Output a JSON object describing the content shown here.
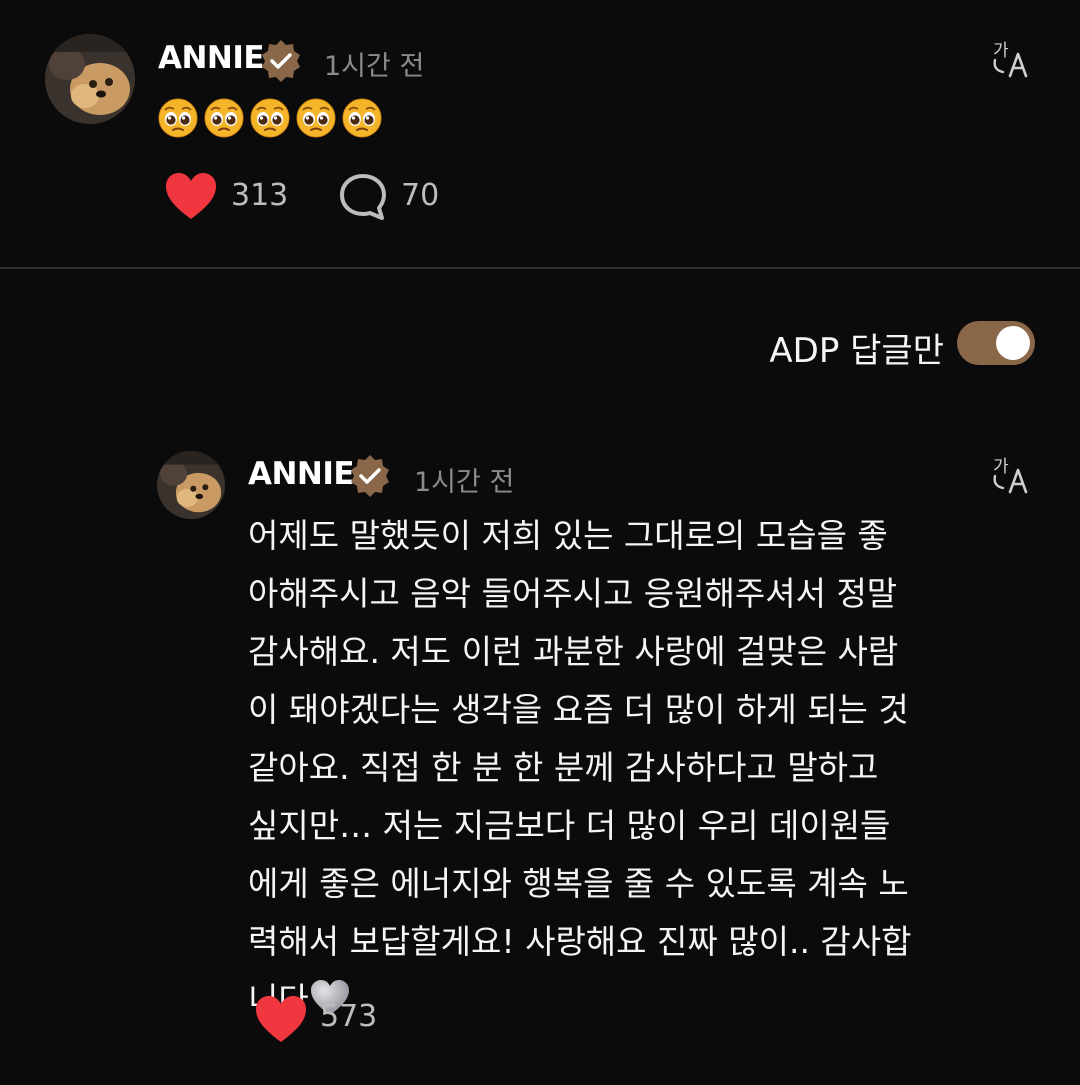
{
  "post": {
    "author": "ANNIE",
    "time": "1시간 전",
    "emojis": [
      "pleading",
      "pleading",
      "pleading",
      "pleading",
      "pleading"
    ],
    "likes": "313",
    "comments": "70"
  },
  "filter": {
    "label": "ADP 답글만",
    "enabled": true
  },
  "reply": {
    "author": "ANNIE",
    "time": "1시간 전",
    "lines": [
      "어제도 말했듯이 저희 있는 그대로의 모습을 좋",
      "아해주시고 음악 들어주시고 응원해주셔서 정말",
      "감사해요. 저도 이런 과분한 사랑에 걸맞은 사람",
      "이 돼야겠다는 생각을 요즘 더 많이 하게 되는 것",
      "같아요. 직접 한 분 한 분께 감사하다고 말하고",
      "싶지만… 저는 지금보다 더 많이 우리 데이원들",
      "에게 좋은 에너지와 행복을 줄 수 있도록 계속 노",
      "력해서 보답할게요! 사랑해요 진짜 많이.. 감사합",
      "니다"
    ],
    "likes": "573"
  },
  "colors": {
    "background": "#0b0b0b",
    "heart": "#f0363f",
    "toggle_on": "#8a6748",
    "badge": "#8a6748"
  }
}
